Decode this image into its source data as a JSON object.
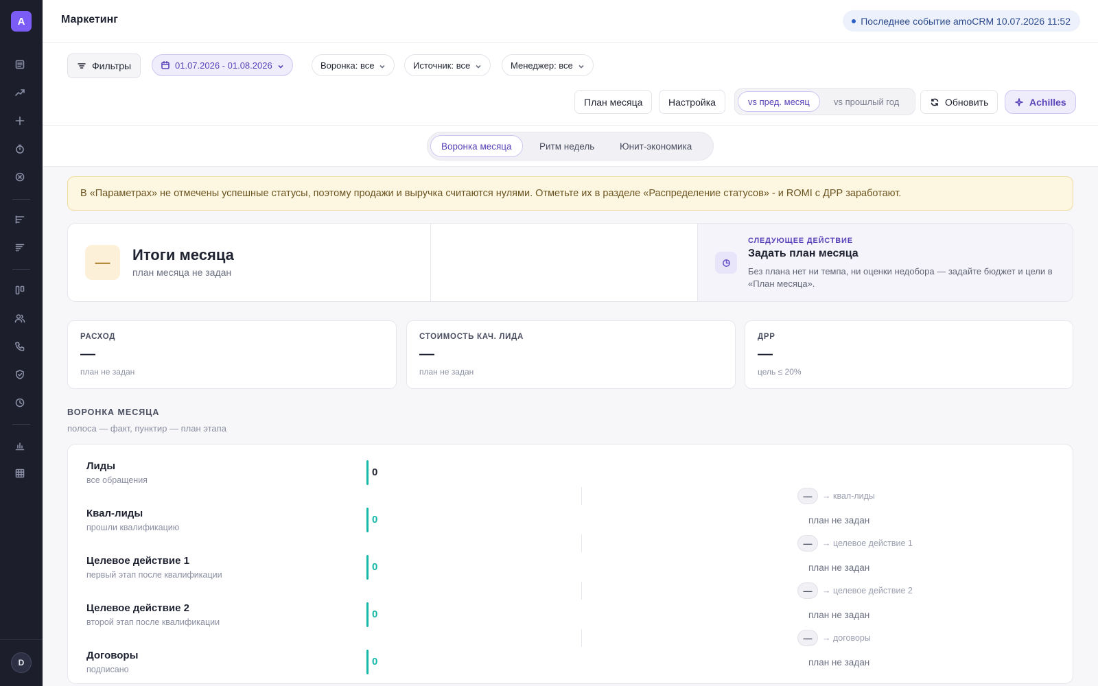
{
  "sidebar": {
    "logo_letter": "A",
    "user_initial": "D",
    "icons": [
      "document-icon",
      "trend-up-icon",
      "plus-icon",
      "timer-icon",
      "circle-x-icon",
      "bar-list-icon",
      "bar-list-alt-icon",
      "kanban-icon",
      "users-icon",
      "phone-icon",
      "shield-check-icon",
      "clock-icon",
      "bar-chart-icon",
      "grid-icon"
    ]
  },
  "header": {
    "title": "Маркетинг",
    "last_event": "Последнее событие amoCRM 10.07.2026 11:52"
  },
  "toolbar": {
    "filters_label": "Фильтры",
    "date_range": "01.07.2026 - 01.08.2026",
    "funnel_filter": "Воронка: все",
    "source_filter": "Источник: все",
    "manager_filter": "Менеджер: все",
    "plan_button": "План месяца",
    "settings_button": "Настройка",
    "compare_prev_month": "vs пред. месяц",
    "compare_prev_year": "vs прошлый год",
    "refresh_button": "Обновить",
    "assistant_button": "Achilles"
  },
  "tabs": [
    {
      "label": "Воронка месяца",
      "active": true
    },
    {
      "label": "Ритм недель",
      "active": false
    },
    {
      "label": "Юнит-экономика",
      "active": false
    }
  ],
  "warning": "В «Параметрах» не отмечены успешные статусы, поэтому продажи и выручка считаются нулями. Отметьте их в разделе «Распределение статусов» - и ROMI с ДРР заработают.",
  "summary": {
    "badge": "—",
    "title": "Итоги месяца",
    "subtitle": "план месяца не задан",
    "next_kicker": "СЛЕДУЮЩЕЕ ДЕЙСТВИЕ",
    "next_title": "Задать план месяца",
    "next_text": "Без плана нет ни темпа, ни оценки недобора — задайте бюджет и цели в «План месяца»."
  },
  "kpis": [
    {
      "label": "РАСХОД",
      "value": "—",
      "note": "план не задан"
    },
    {
      "label": "СТОИМОСТЬ КАЧ. ЛИДА",
      "value": "—",
      "note": "план не задан"
    },
    {
      "label": "ДРР",
      "value": "—",
      "note": "цель ≤ 20%"
    }
  ],
  "funnel": {
    "heading": "ВОРОНКА МЕСЯЦА",
    "legend": "полоса — факт, пунктир — план этапа",
    "stages": [
      {
        "name": "Лиды",
        "desc": "все обращения",
        "value": "0"
      },
      {
        "name": "Квал-лиды",
        "desc": "прошли квалификацию",
        "value": "0"
      },
      {
        "name": "Целевое действие 1",
        "desc": "первый этап после квалификации",
        "value": "0"
      },
      {
        "name": "Целевое действие 2",
        "desc": "второй этап после квалификации",
        "value": "0"
      },
      {
        "name": "Договоры",
        "desc": "подписано",
        "value": "0"
      }
    ],
    "conversions": [
      {
        "badge": "—",
        "target": "→ квал-лиды",
        "plan": "план не задан"
      },
      {
        "badge": "—",
        "target": "→ целевое действие 1",
        "plan": "план не задан"
      },
      {
        "badge": "—",
        "target": "→ целевое действие 2",
        "plan": "план не задан"
      },
      {
        "badge": "—",
        "target": "→ договоры",
        "plan": "план не задан"
      }
    ]
  }
}
